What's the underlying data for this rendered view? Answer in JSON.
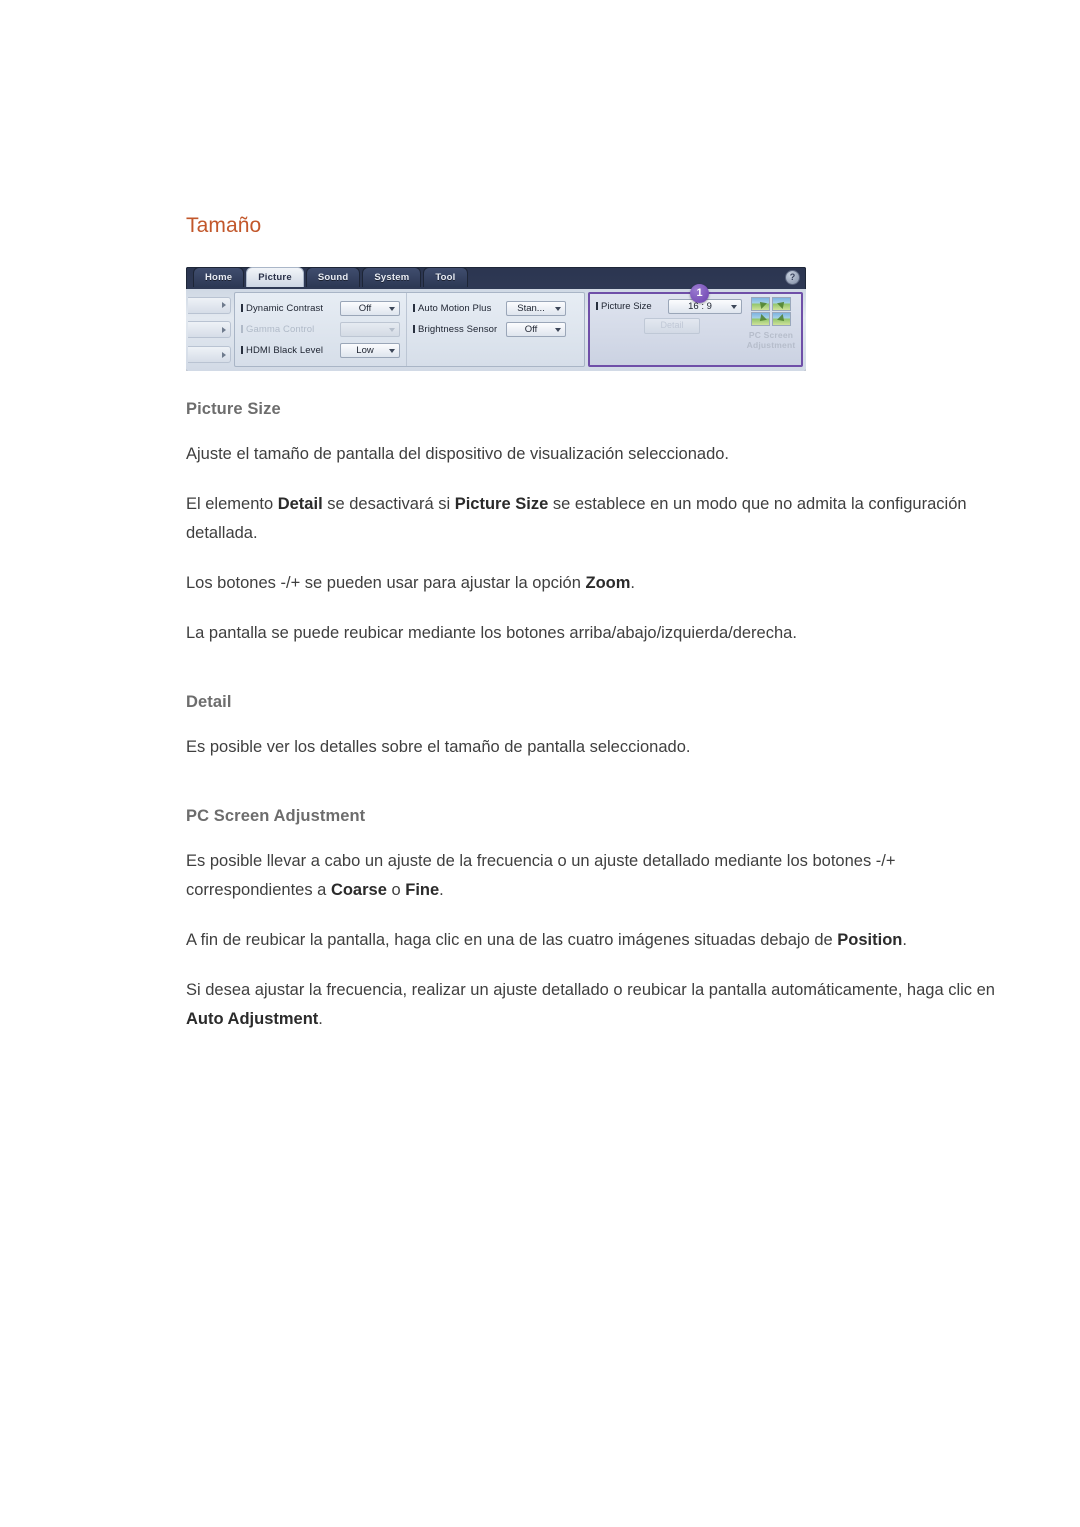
{
  "page": {
    "title": "Tamaño"
  },
  "osd": {
    "tabs": [
      {
        "label": "Home",
        "active": false
      },
      {
        "label": "Picture",
        "active": true
      },
      {
        "label": "Sound",
        "active": false
      },
      {
        "label": "System",
        "active": false
      },
      {
        "label": "Tool",
        "active": false
      }
    ],
    "help_icon": "?",
    "badge": "1",
    "column1": [
      {
        "label": "Dynamic Contrast",
        "value": "Off",
        "disabled": false
      },
      {
        "label": "Gamma Control",
        "value": "",
        "disabled": true
      },
      {
        "label": "HDMI Black Level",
        "value": "Low",
        "disabled": false
      }
    ],
    "column2": [
      {
        "label": "Auto Motion Plus",
        "value": "Stan...",
        "disabled": false
      },
      {
        "label": "Brightness Sensor",
        "value": "Off",
        "disabled": false
      }
    ],
    "highlight": {
      "picture_size_label": "Picture Size",
      "picture_size_value": "16 : 9",
      "detail_button": "Detail",
      "pc_screen_label_line1": "PC Screen",
      "pc_screen_label_line2": "Adjustment"
    },
    "colors": {
      "highlight_border": "#6f4fa8",
      "badge": "#6b3fae",
      "heading": "#c2572b"
    }
  },
  "sections": [
    {
      "heading": "Picture Size",
      "paragraphs": [
        [
          {
            "t": "Ajuste el tamaño de pantalla del dispositivo de visualización seleccionado.",
            "b": false
          }
        ],
        [
          {
            "t": "El elemento ",
            "b": false
          },
          {
            "t": "Detail",
            "b": true
          },
          {
            "t": " se desactivará si ",
            "b": false
          },
          {
            "t": "Picture Size",
            "b": true
          },
          {
            "t": " se establece en un modo que no admita la configuración detallada.",
            "b": false
          }
        ],
        [
          {
            "t": "Los botones -/+ se pueden usar para ajustar la opción ",
            "b": false
          },
          {
            "t": "Zoom",
            "b": true
          },
          {
            "t": ".",
            "b": false
          }
        ],
        [
          {
            "t": "La pantalla se puede reubicar mediante los botones arriba/abajo/izquierda/derecha.",
            "b": false
          }
        ]
      ]
    },
    {
      "heading": "Detail",
      "paragraphs": [
        [
          {
            "t": "Es posible ver los detalles sobre el tamaño de pantalla seleccionado.",
            "b": false
          }
        ]
      ]
    },
    {
      "heading": "PC Screen Adjustment",
      "paragraphs": [
        [
          {
            "t": "Es posible llevar a cabo un ajuste de la frecuencia o un ajuste detallado mediante los botones -/+ correspondientes a ",
            "b": false
          },
          {
            "t": "Coarse",
            "b": true
          },
          {
            "t": " o ",
            "b": false
          },
          {
            "t": "Fine",
            "b": true
          },
          {
            "t": ".",
            "b": false
          }
        ],
        [
          {
            "t": "A fin de reubicar la pantalla, haga clic en una de las cuatro imágenes situadas debajo de ",
            "b": false
          },
          {
            "t": "Position",
            "b": true
          },
          {
            "t": ".",
            "b": false
          }
        ],
        [
          {
            "t": "Si desea ajustar la frecuencia, realizar un ajuste detallado o reubicar la pantalla automáticamente, haga clic en ",
            "b": false
          },
          {
            "t": "Auto Adjustment",
            "b": true
          },
          {
            "t": ".",
            "b": false
          }
        ]
      ]
    }
  ]
}
